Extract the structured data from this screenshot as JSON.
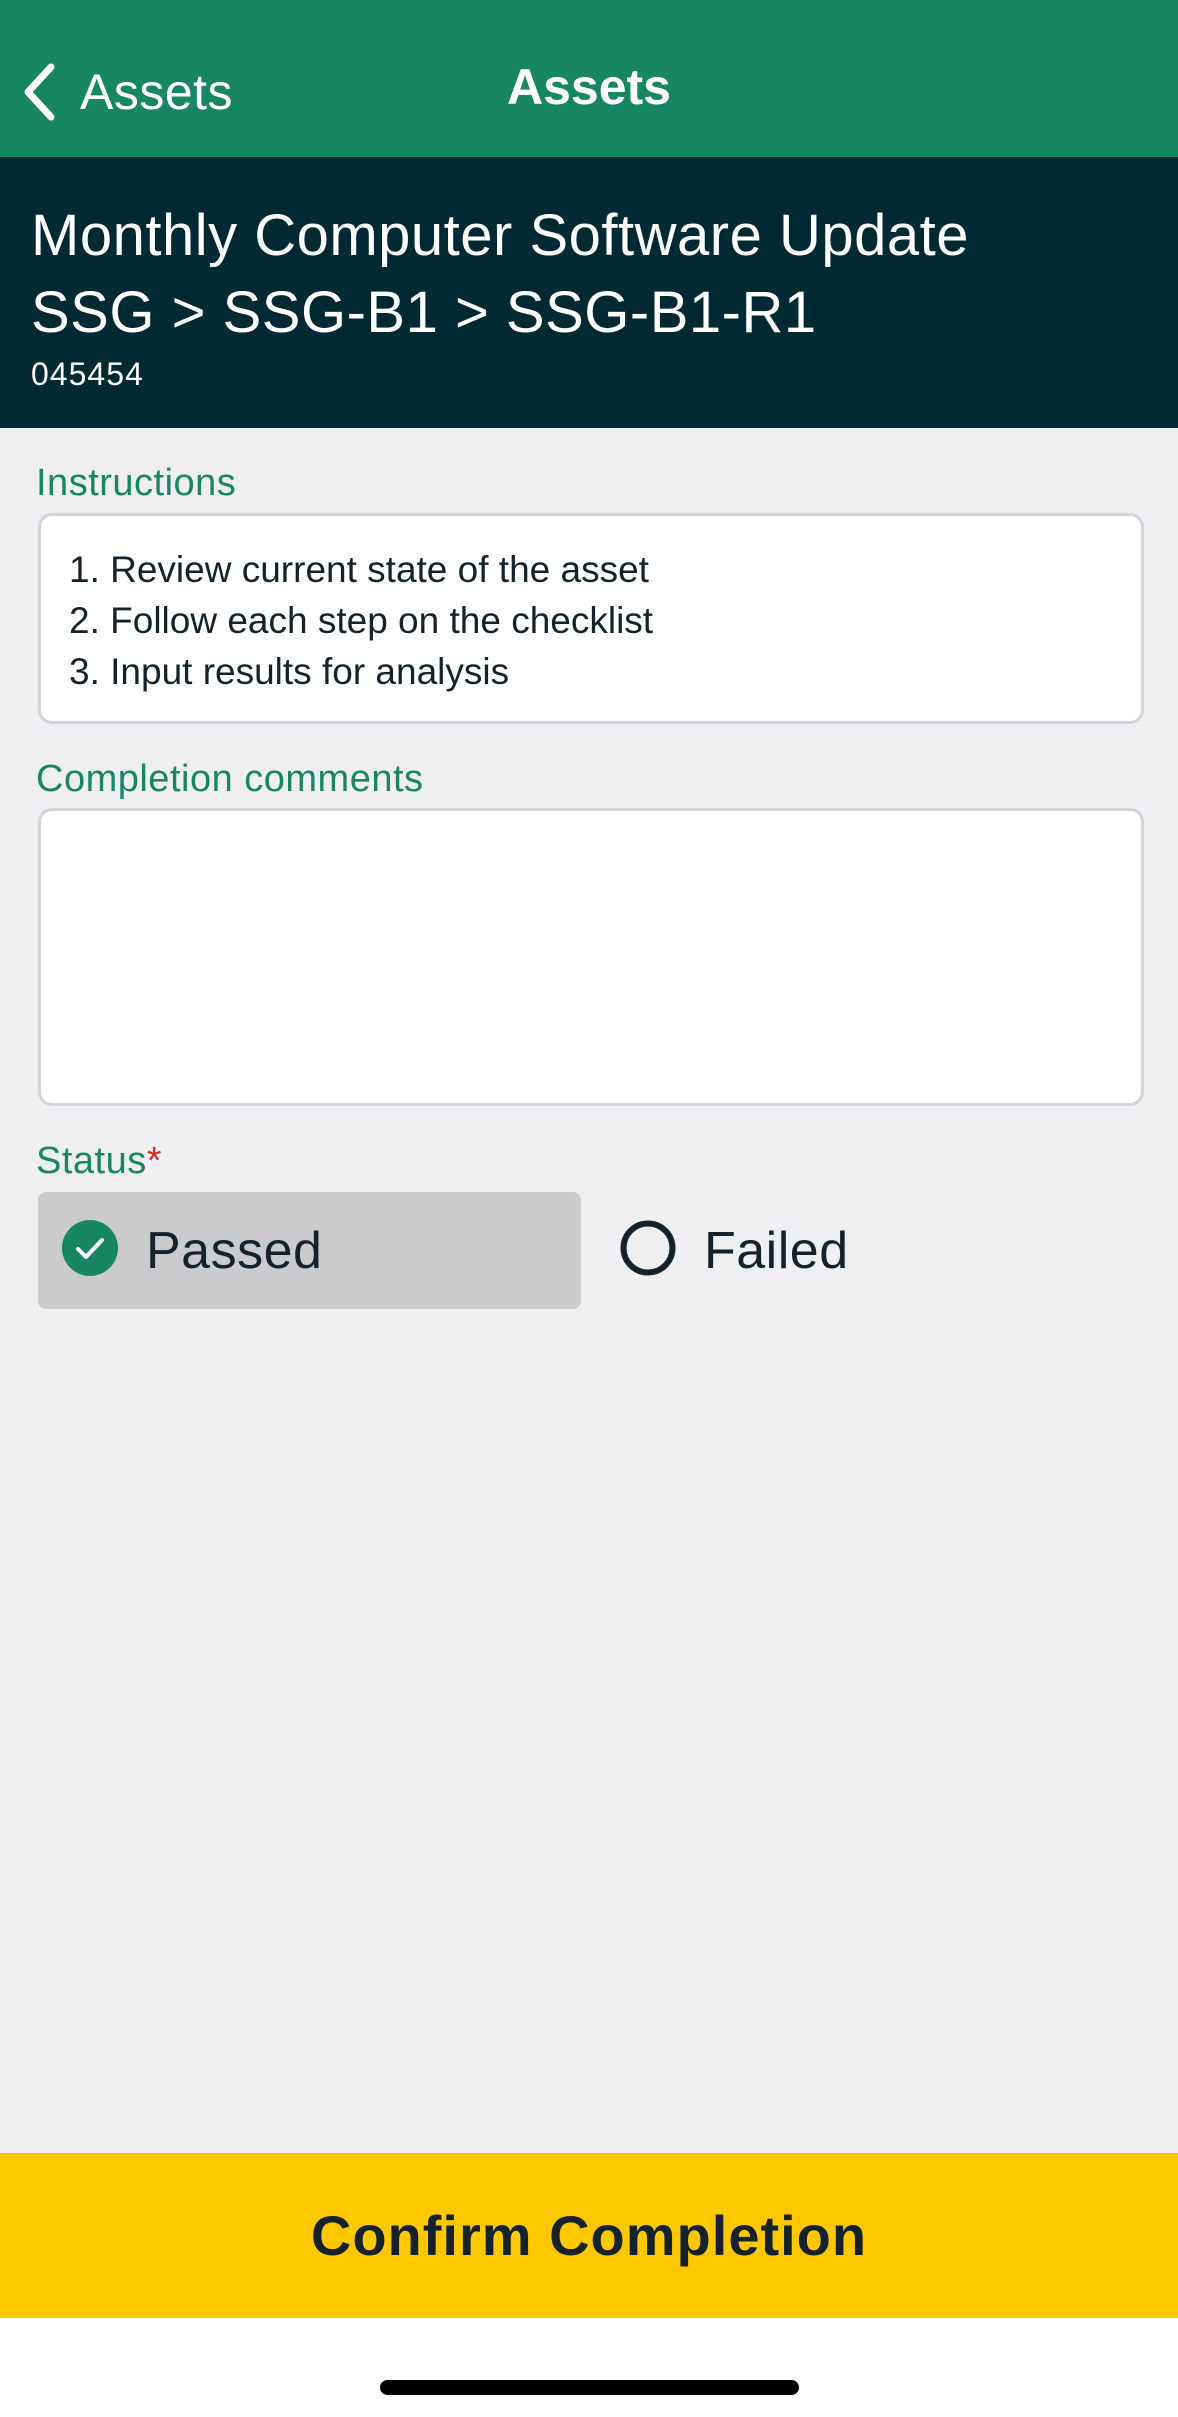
{
  "navbar": {
    "back_label": "Assets",
    "title": "Assets"
  },
  "header": {
    "title": "Monthly Computer Software Update",
    "path": "SSG > SSG-B1 > SSG-B1-R1",
    "code": "045454"
  },
  "instructions": {
    "label": "Instructions",
    "items": [
      "1. Review current state of the asset",
      "2. Follow each step on the checklist",
      "3. Input results for analysis"
    ]
  },
  "comments": {
    "label": "Completion comments",
    "value": ""
  },
  "status": {
    "label": "Status",
    "required_mark": "*",
    "options": [
      {
        "label": "Passed",
        "selected": true
      },
      {
        "label": "Failed",
        "selected": false
      }
    ]
  },
  "confirm": {
    "label": "Confirm Completion"
  },
  "colors": {
    "primary": "#188563",
    "header_bg": "#002933",
    "accent": "#fdc800",
    "required": "#d12b2b"
  }
}
